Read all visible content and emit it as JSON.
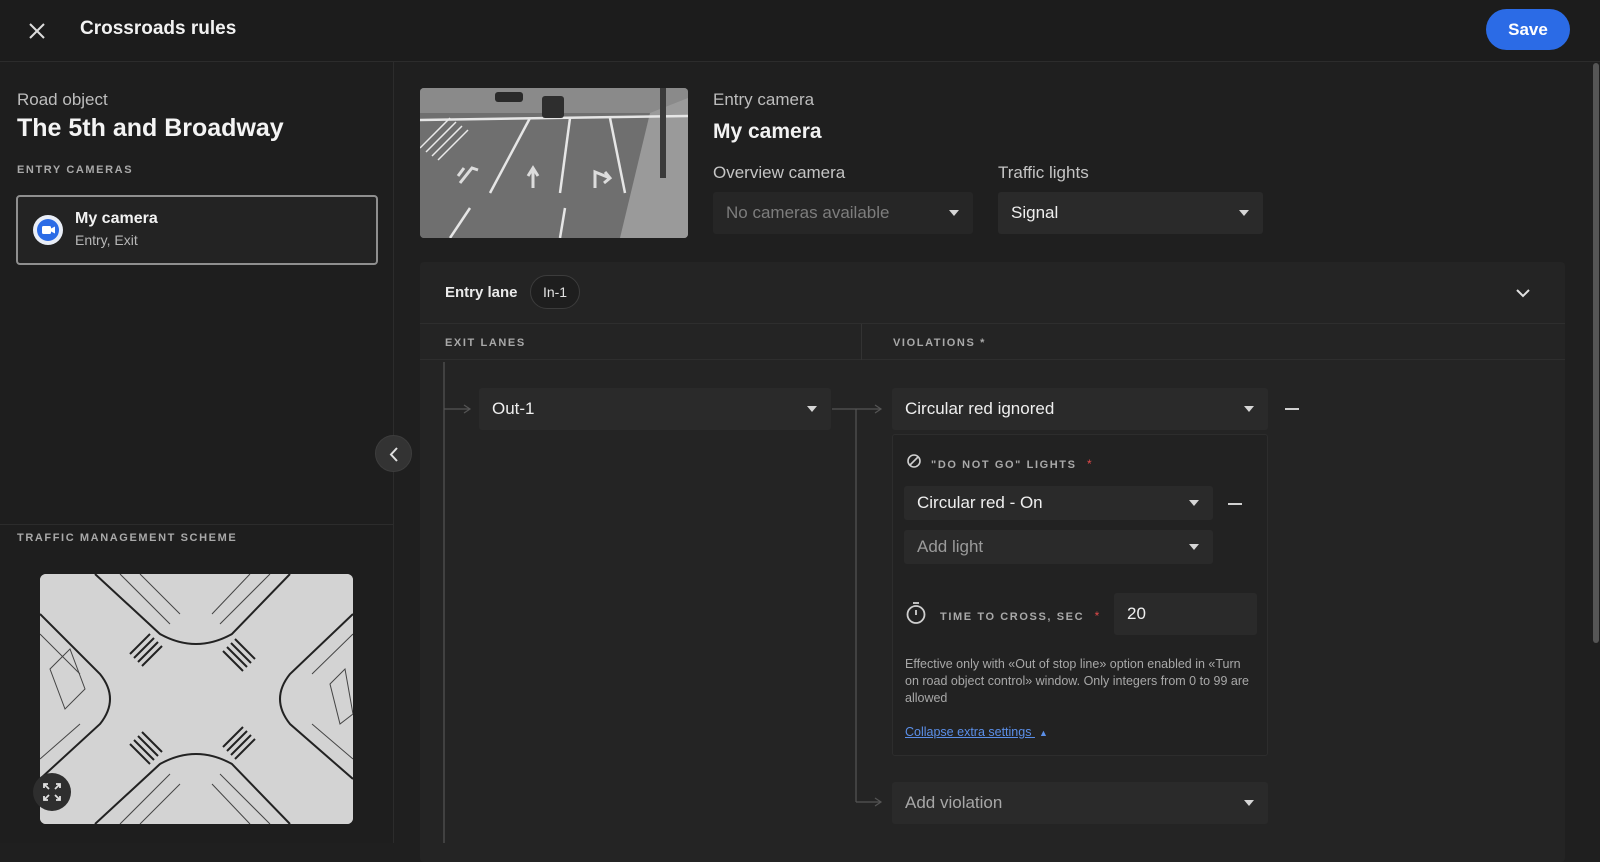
{
  "header": {
    "title": "Crossroads rules",
    "save_label": "Save"
  },
  "sidebar": {
    "road_object_label": "Road object",
    "road_object_name": "The 5th and Broadway",
    "entry_cameras_caption": "ENTRY CAMERAS",
    "cameras": [
      {
        "name": "My camera",
        "sub": "Entry, Exit"
      }
    ],
    "scheme_caption": "TRAFFIC MANAGEMENT SCHEME"
  },
  "camera": {
    "entry_label": "Entry camera",
    "entry_name": "My camera",
    "overview_label": "Overview camera",
    "overview_value": "No cameras available",
    "traffic_lights_label": "Traffic lights",
    "traffic_lights_value": "Signal"
  },
  "lane": {
    "entry_lane_label": "Entry lane",
    "entry_lane_value": "In-1",
    "exit_lanes_caption": "EXIT LANES",
    "violations_caption": "VIOLATIONS",
    "required_mark": "*",
    "exit_lane_value": "Out-1",
    "violation_value": "Circular red ignored",
    "do_not_go_caption": "\"DO NOT GO\" LIGHTS",
    "light_value": "Circular red - On",
    "add_light_placeholder": "Add light",
    "time_caption": "TIME TO CROSS, SEC",
    "time_value": "20",
    "help_text": "Effective only with «Out of stop line» option enabled in «Turn on road object control» window. Only integers from 0 to 99 are allowed",
    "collapse_link": "Collapse extra settings",
    "add_violation_placeholder": "Add violation"
  },
  "icons": {
    "close": "close-icon",
    "camera": "camera-icon",
    "chevron_left": "chevron-left-icon",
    "chevron_down": "chevron-down-icon",
    "expand": "expand-icon",
    "block": "block-icon",
    "timer": "timer-icon"
  },
  "colors": {
    "accent": "#2b6be6",
    "required": "#e24a4a",
    "link": "#5b8fe8"
  }
}
